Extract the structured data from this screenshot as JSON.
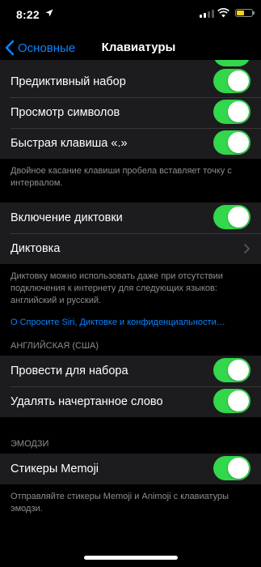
{
  "status_bar": {
    "time": "8:22"
  },
  "nav": {
    "back_label": "Основные",
    "title": "Клавиатуры"
  },
  "group1": [
    {
      "label": "Предиктивный набор",
      "on": true
    },
    {
      "label": "Просмотр символов",
      "on": true
    },
    {
      "label": "Быстрая клавиша «.»",
      "on": true
    }
  ],
  "group1_footer": "Двойное касание клавиши пробела вставляет точку с интервалом.",
  "group2": {
    "dictation_toggle_label": "Включение диктовки",
    "dictation_link_label": "Диктовка"
  },
  "group2_footer": "Диктовку можно использовать даже при отсутствии подключения к интернету для следующих языков: английский и русский.",
  "group2_link": "О Спросите Siri, Диктовке и конфиденциальности…",
  "section_english": {
    "header": "Английская (США)",
    "rows": [
      {
        "label": "Провести для набора",
        "on": true
      },
      {
        "label": "Удалять начертанное слово",
        "on": true
      }
    ]
  },
  "section_emoji": {
    "header": "Эмодзи",
    "row_label": "Стикеры Memoji",
    "footer": "Отправляйте стикеры Memoji и Animoji с клавиатуры эмодзи."
  },
  "colors": {
    "accent": "#0a84ff",
    "switch_on": "#32d74b",
    "cell": "#1c1c1e",
    "background": "#000000"
  }
}
